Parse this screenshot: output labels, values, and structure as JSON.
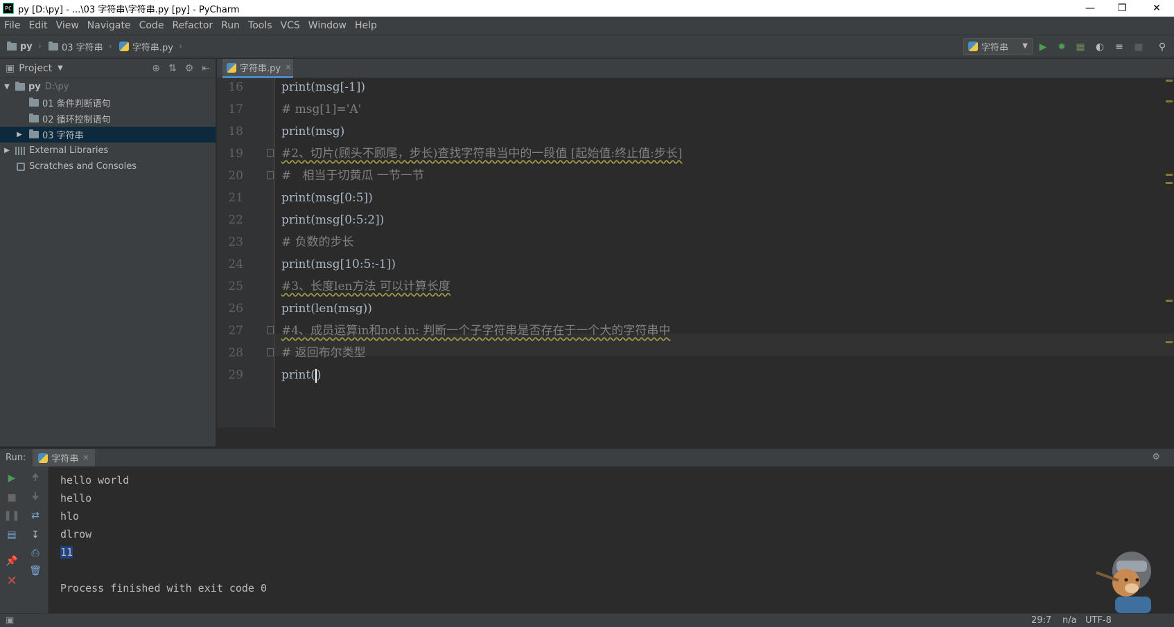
{
  "window": {
    "title": "py [D:\\py] - ...\\03 字符串\\字符串.py [py] - PyCharm",
    "app_icon": "PC"
  },
  "menu": [
    "File",
    "Edit",
    "View",
    "Navigate",
    "Code",
    "Refactor",
    "Run",
    "Tools",
    "VCS",
    "Window",
    "Help"
  ],
  "breadcrumbs": [
    "py",
    "03 字符串",
    "字符串.py"
  ],
  "run_config": "字符串",
  "project": {
    "header": "Project",
    "tree": [
      {
        "label": "py",
        "path": "D:\\py",
        "depth": 0,
        "expanded": true
      },
      {
        "label": "01 条件判断语句",
        "depth": 1
      },
      {
        "label": "02 循环控制语句",
        "depth": 1
      },
      {
        "label": "03 字符串",
        "depth": 1,
        "selected": true
      },
      {
        "label": "External Libraries",
        "depth": 0
      },
      {
        "label": "Scratches and Consoles",
        "depth": 0
      }
    ]
  },
  "editor": {
    "tab": "字符串.py",
    "lines": [
      {
        "no": "16",
        "text": "print(msg[-1])"
      },
      {
        "no": "17",
        "text": "# msg[1]='A'"
      },
      {
        "no": "18",
        "text": "print(msg)"
      },
      {
        "no": "19",
        "text": "#2、切片(顾头不顾尾，步长)查找字符串当中的一段值 [起始值:终止值:步长]"
      },
      {
        "no": "20",
        "text": "#   相当于切黄瓜 一节一节"
      },
      {
        "no": "21",
        "text": "print(msg[0:5])"
      },
      {
        "no": "22",
        "text": "print(msg[0:5:2])"
      },
      {
        "no": "23",
        "text": "# 负数的步长"
      },
      {
        "no": "24",
        "text": "print(msg[10:5:-1])"
      },
      {
        "no": "25",
        "text": "#3、长度len方法 可以计算长度"
      },
      {
        "no": "26",
        "text": "print(len(msg))"
      },
      {
        "no": "27",
        "text": "#4、成员运算in和not in: 判断一个子字符串是否存在于一个大的字符串中"
      },
      {
        "no": "28",
        "text": "# 返回布尔类型"
      },
      {
        "no": "29",
        "text": "print("
      }
    ],
    "cursor_line_tail": ")"
  },
  "run": {
    "label": "Run:",
    "tab": "字符串",
    "output": [
      "hello world",
      "hello",
      "hlo",
      "dlrow",
      "11",
      "",
      "Process finished with exit code 0"
    ],
    "selected_output": "11"
  },
  "status": {
    "position": "29:7",
    "separator": "n/a",
    "encoding": "UTF-8"
  },
  "colors": {
    "background": "#2b2b2b",
    "panel": "#3c3f41",
    "code": "#a9b7c6",
    "comment": "#808080",
    "selection": "#0d293e",
    "accent": "#4a88c7",
    "run_green": "#499c54",
    "stop_red": "#c75450"
  }
}
